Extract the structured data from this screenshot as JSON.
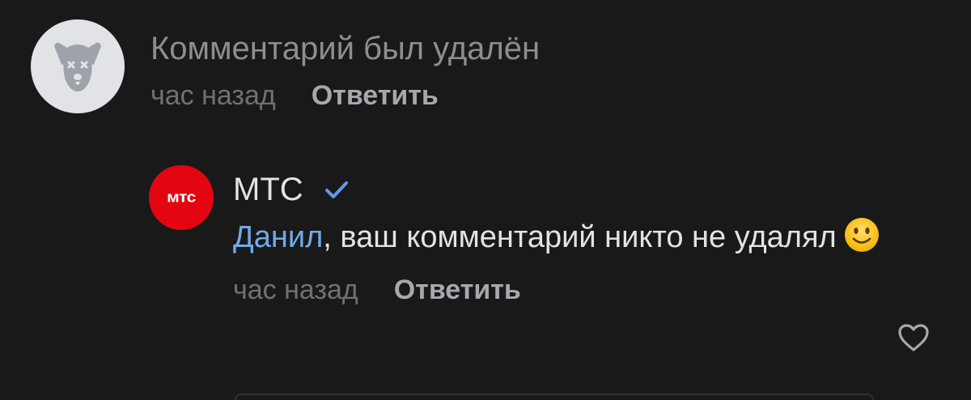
{
  "comments": [
    {
      "avatar_icon": "deleted-user-dog-icon",
      "text": "Комментарий был удалён",
      "time": "час назад",
      "reply_label": "Ответить"
    },
    {
      "author": "МТС",
      "avatar_text": "мтс",
      "verified_icon": "verified-check-icon",
      "mention": "Данил",
      "text_after_mention": ", ваш комментарий никто не удалял",
      "emoji": "smiling-face-icon",
      "time": "час назад",
      "reply_label": "Ответить",
      "like_icon": "heart-outline-icon"
    }
  ],
  "colors": {
    "background": "#19191a",
    "text_primary": "#e1e3e6",
    "text_secondary": "#8c8e92",
    "link": "#71aaeb",
    "mts_red": "#e30611",
    "verified_blue": "#5b9be6"
  }
}
